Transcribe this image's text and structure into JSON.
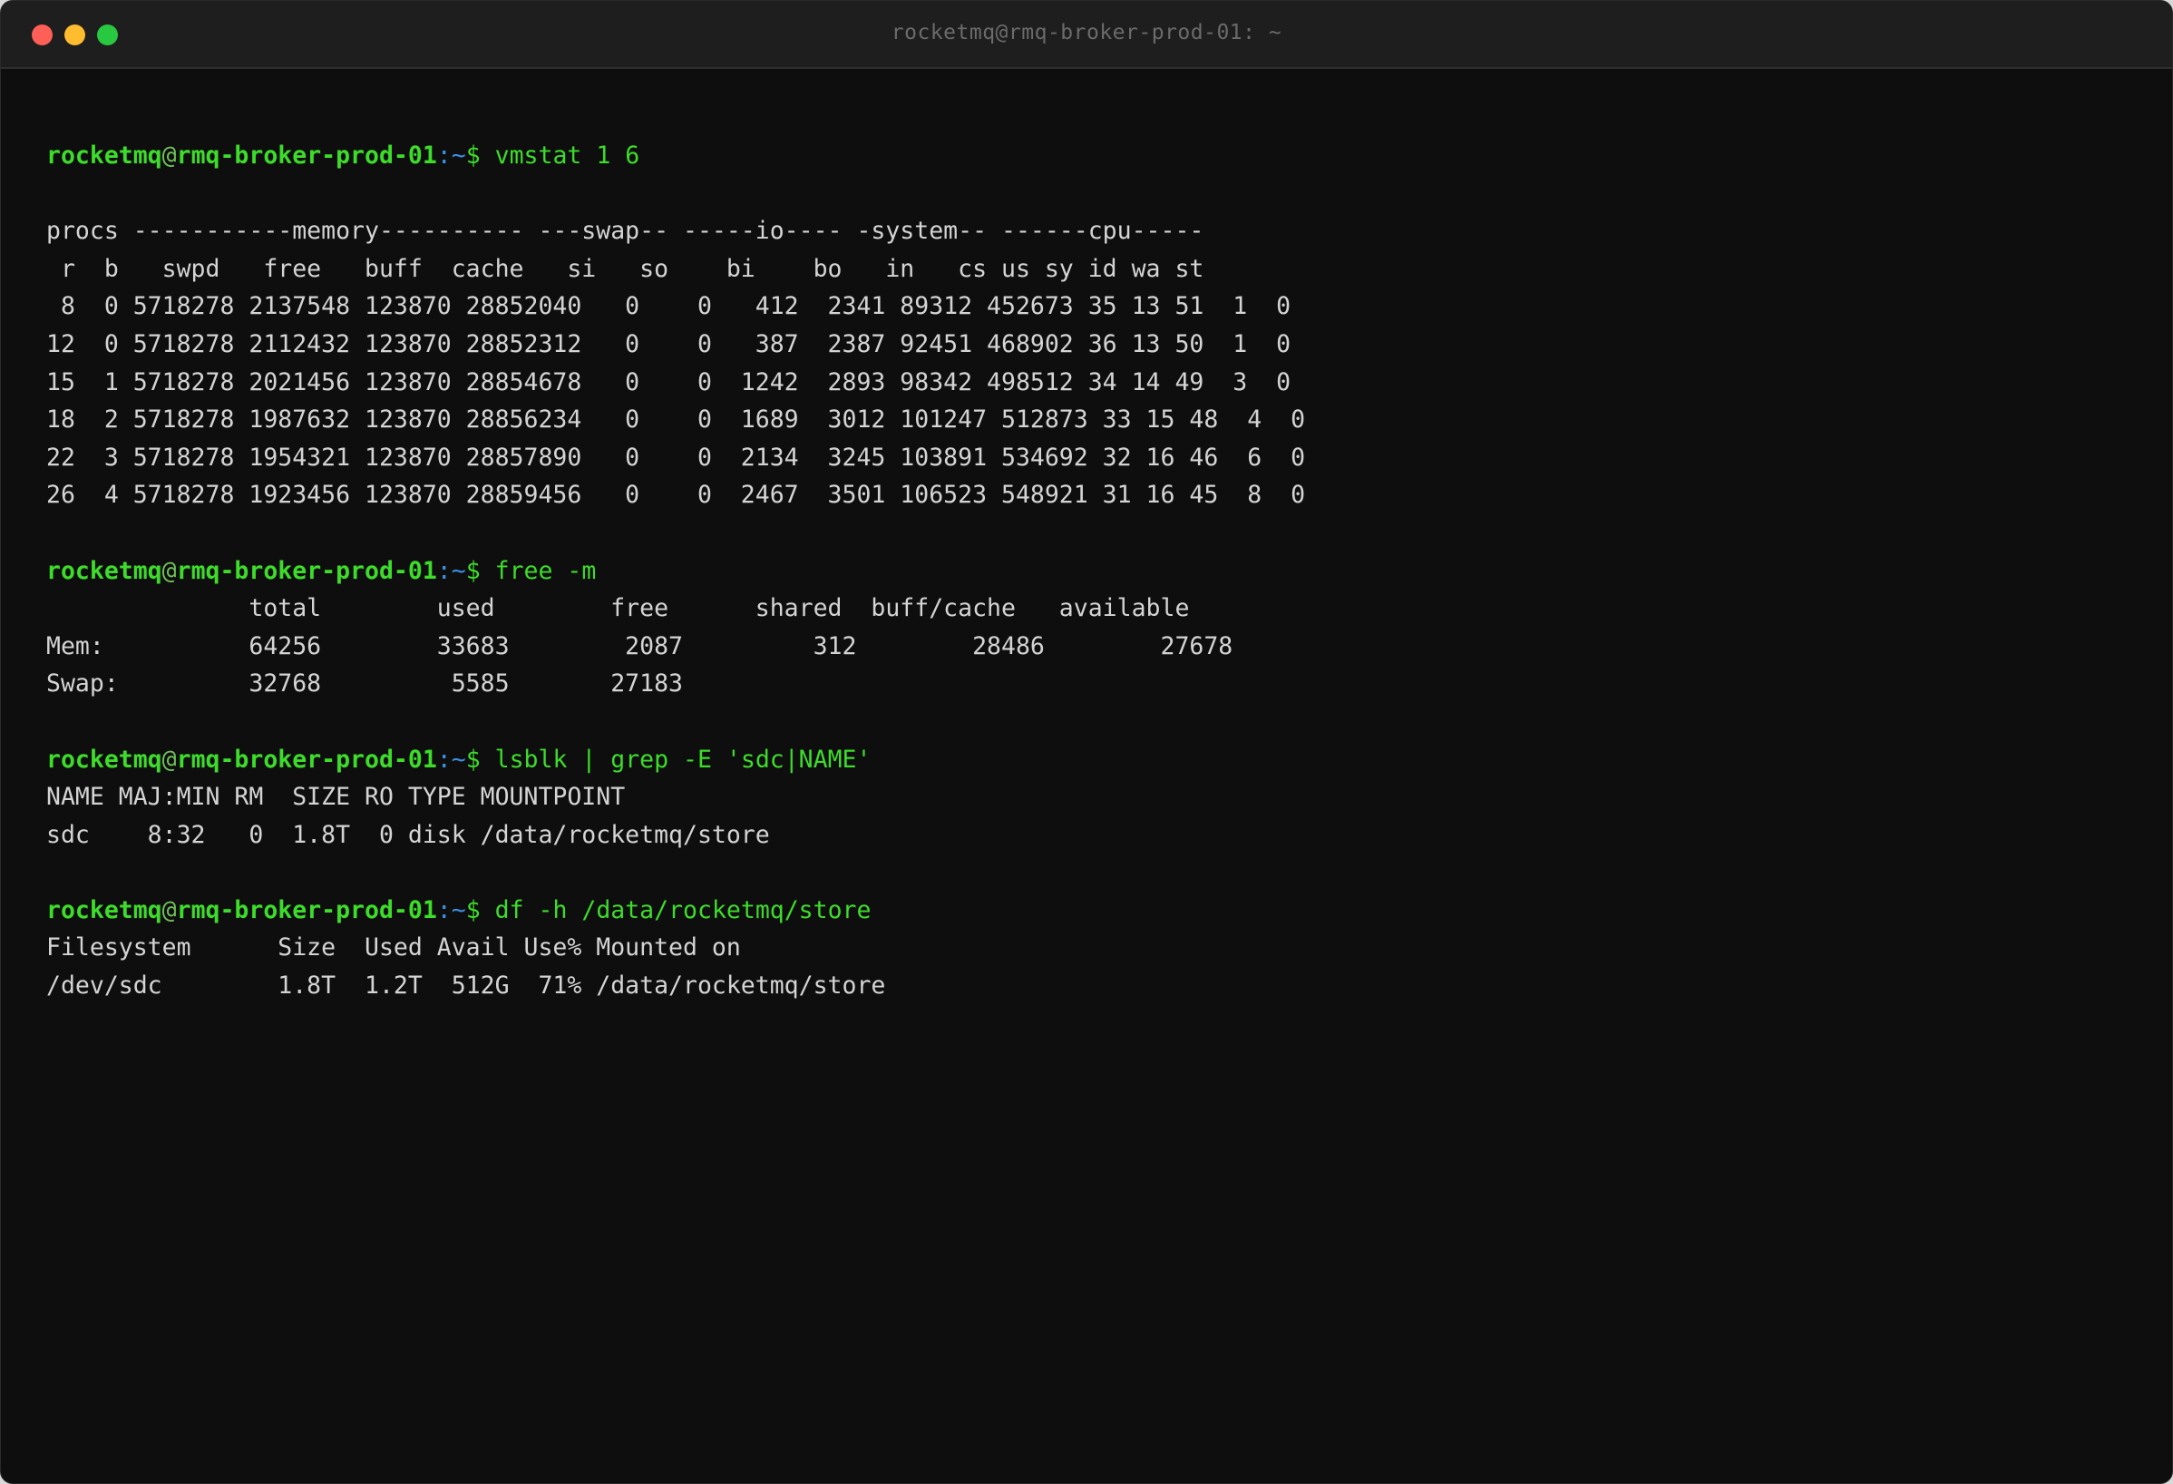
{
  "window": {
    "title": "rocketmq@rmq-broker-prod-01: ~"
  },
  "prompt": {
    "user": "rocketmq",
    "at": "@",
    "host": "rmq-broker-prod-01",
    "path": ":~",
    "dollar": "$ "
  },
  "blocks": [
    {
      "command": "vmstat 1 6",
      "output": [
        "",
        "procs -----------memory---------- ---swap-- -----io---- -system-- ------cpu-----",
        " r  b   swpd   free   buff  cache   si   so    bi    bo   in   cs us sy id wa st",
        " 8  0 5718278 2137548 123870 28852040   0    0   412  2341 89312 452673 35 13 51  1  0",
        "12  0 5718278 2112432 123870 28852312   0    0   387  2387 92451 468902 36 13 50  1  0",
        "15  1 5718278 2021456 123870 28854678   0    0  1242  2893 98342 498512 34 14 49  3  0",
        "18  2 5718278 1987632 123870 28856234   0    0  1689  3012 101247 512873 33 15 48  4  0",
        "22  3 5718278 1954321 123870 28857890   0    0  2134  3245 103891 534692 32 16 46  6  0",
        "26  4 5718278 1923456 123870 28859456   0    0  2467  3501 106523 548921 31 16 45  8  0"
      ]
    },
    {
      "command": "free -m",
      "output": [
        "              total        used        free      shared  buff/cache   available",
        "Mem:          64256        33683        2087         312        28486        27678",
        "Swap:         32768         5585       27183"
      ]
    },
    {
      "command": "lsblk | grep -E 'sdc|NAME'",
      "output": [
        "NAME MAJ:MIN RM  SIZE RO TYPE MOUNTPOINT",
        "sdc    8:32   0  1.8T  0 disk /data/rocketmq/store"
      ]
    },
    {
      "command": "df -h /data/rocketmq/store",
      "output": [
        "Filesystem      Size  Used Avail Use% Mounted on",
        "/dev/sdc        1.8T  1.2T  512G  71% /data/rocketmq/store"
      ]
    }
  ]
}
